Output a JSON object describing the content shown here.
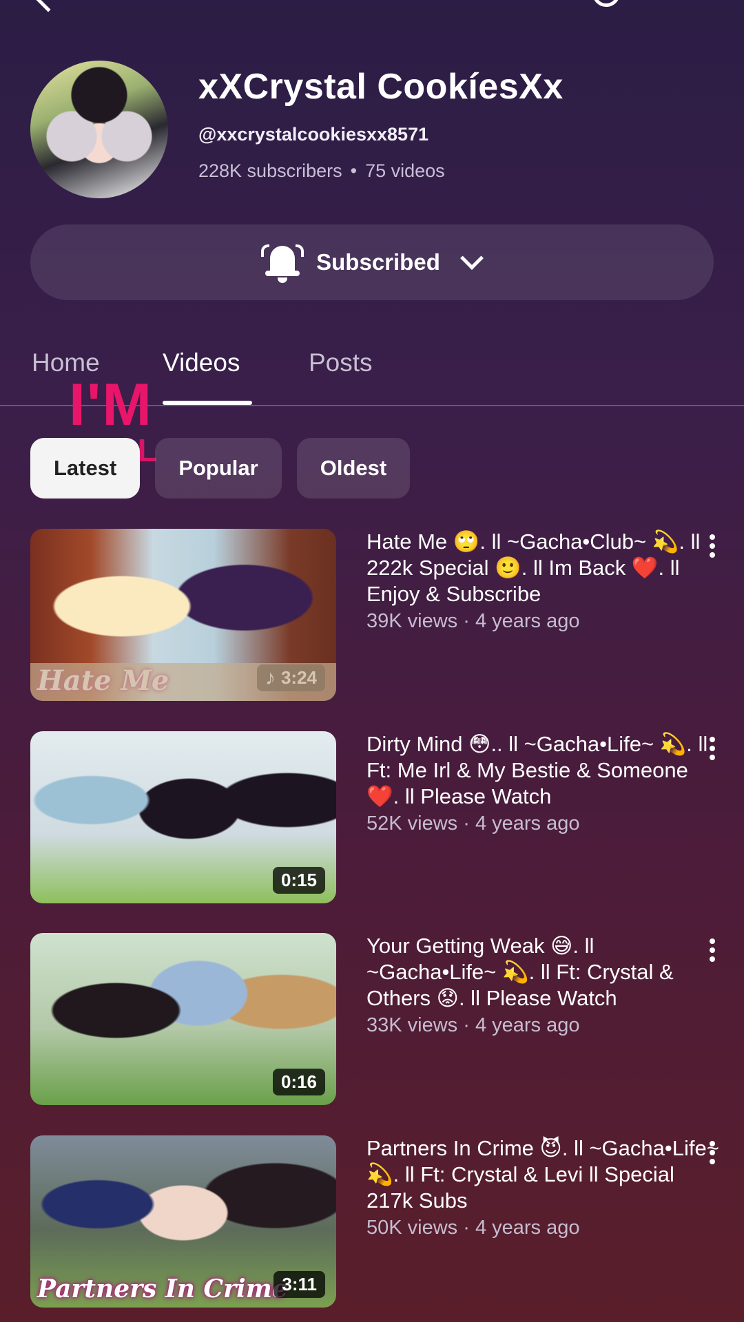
{
  "channel": {
    "name": "xXCrystal CookíesXx",
    "handle": "@xxcrystalcookiesxx8571",
    "subscribers": "228K subscribers",
    "videos_count": "75 videos",
    "separator": "•"
  },
  "subscribe_button": {
    "label": "Subscribed"
  },
  "tabs": [
    {
      "label": "Home",
      "active": false
    },
    {
      "label": "Videos",
      "active": true
    },
    {
      "label": "Posts",
      "active": false
    }
  ],
  "sticker": {
    "big": "I'M",
    "small": "STILL",
    "color": "#e8156a"
  },
  "filters": [
    {
      "label": "Latest",
      "active": true
    },
    {
      "label": "Popular",
      "active": false
    },
    {
      "label": "Oldest",
      "active": false
    }
  ],
  "videos": [
    {
      "title": "Hate Me 🙄. ll ~Gacha•Club~ 💫. ll 222k Special 🙂. ll Im Back ❤️. ll Enjoy & Subscribe",
      "meta": "39K views · 4 years ago",
      "duration": "3:24",
      "thumb_caption": "Hate Me",
      "has_music_icon": true
    },
    {
      "title": "Dirty Mind 😳.. ll ~Gacha•Life~ 💫. ll Ft: Me Irl & My Bestie & Someone ❤️. ll Please Watch",
      "meta": "52K views · 4 years ago",
      "duration": "0:15"
    },
    {
      "title": "Your Getting Weak 😅. ll ~Gacha•Life~ 💫. ll Ft: Crystal & Others 😟. ll Please Watch",
      "meta": "33K views · 4 years ago",
      "duration": "0:16"
    },
    {
      "title": "Partners In Crime 😈. ll ~Gacha•Life~ 💫. ll Ft: Crystal & Levi ll Special 217k Subs",
      "meta": "50K views · 4 years ago",
      "duration": "3:11",
      "thumb_caption": "Partners In Crime"
    }
  ],
  "icons": {
    "back": "back-arrow-icon",
    "search": "search-icon",
    "more": "more-vert-icon",
    "bell": "bell-icon",
    "chevron": "chevron-down-icon",
    "music": "music-note-icon",
    "music_glyph": "♪"
  }
}
